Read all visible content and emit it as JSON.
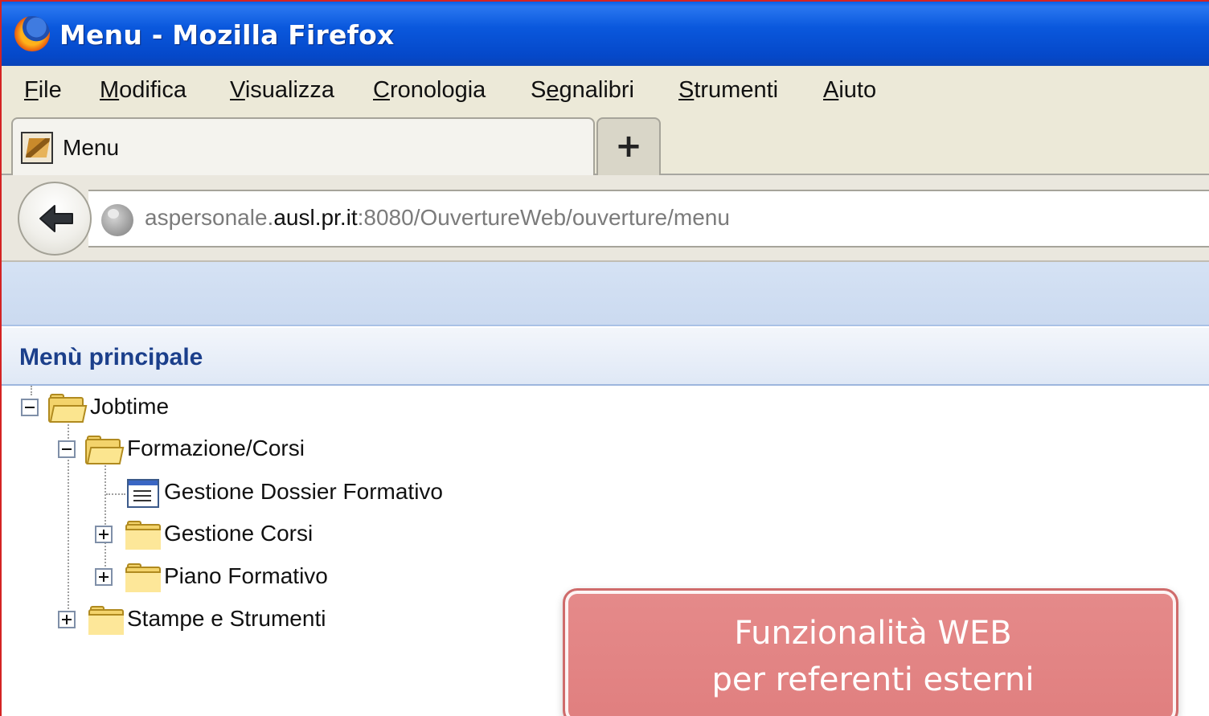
{
  "window": {
    "title": "Menu - Mozilla Firefox"
  },
  "menubar": {
    "items": [
      {
        "label": "File",
        "accel": "F",
        "rest": "ile"
      },
      {
        "label": "Modifica",
        "accel": "M",
        "rest": "odifica"
      },
      {
        "label": "Visualizza",
        "accel": "V",
        "rest": "isualizza"
      },
      {
        "label": "Cronologia",
        "accel": "C",
        "rest": "ronologia"
      },
      {
        "label": "Segnalibri",
        "pre": "S",
        "accel": "e",
        "rest": "gnalibri"
      },
      {
        "label": "Strumenti",
        "accel": "S",
        "rest": "trumenti"
      },
      {
        "label": "Aiuto",
        "accel": "A",
        "rest": "iuto"
      }
    ]
  },
  "tabs": {
    "active_label": "Menu",
    "new_tab_symbol": "+"
  },
  "navbar": {
    "url_prefix": "aspersonale.",
    "url_host": "ausl.pr.it",
    "url_suffix": ":8080/OuvertureWeb/ouverture/menu"
  },
  "page": {
    "section_title": "Menù principale",
    "tree": {
      "root": "Jobtime",
      "formazione": "Formazione/Corsi",
      "dossier": "Gestione Dossier Formativo",
      "corsi": "Gestione Corsi",
      "piano": "Piano Formativo",
      "stampe": "Stampe e Strumenti"
    }
  },
  "callout": {
    "line1": "Funzionalità WEB",
    "line2": "per referenti esterni"
  },
  "colors": {
    "titlebar": "#0548c9",
    "callout": "#e58a8a",
    "section_title": "#1b3f8b"
  }
}
